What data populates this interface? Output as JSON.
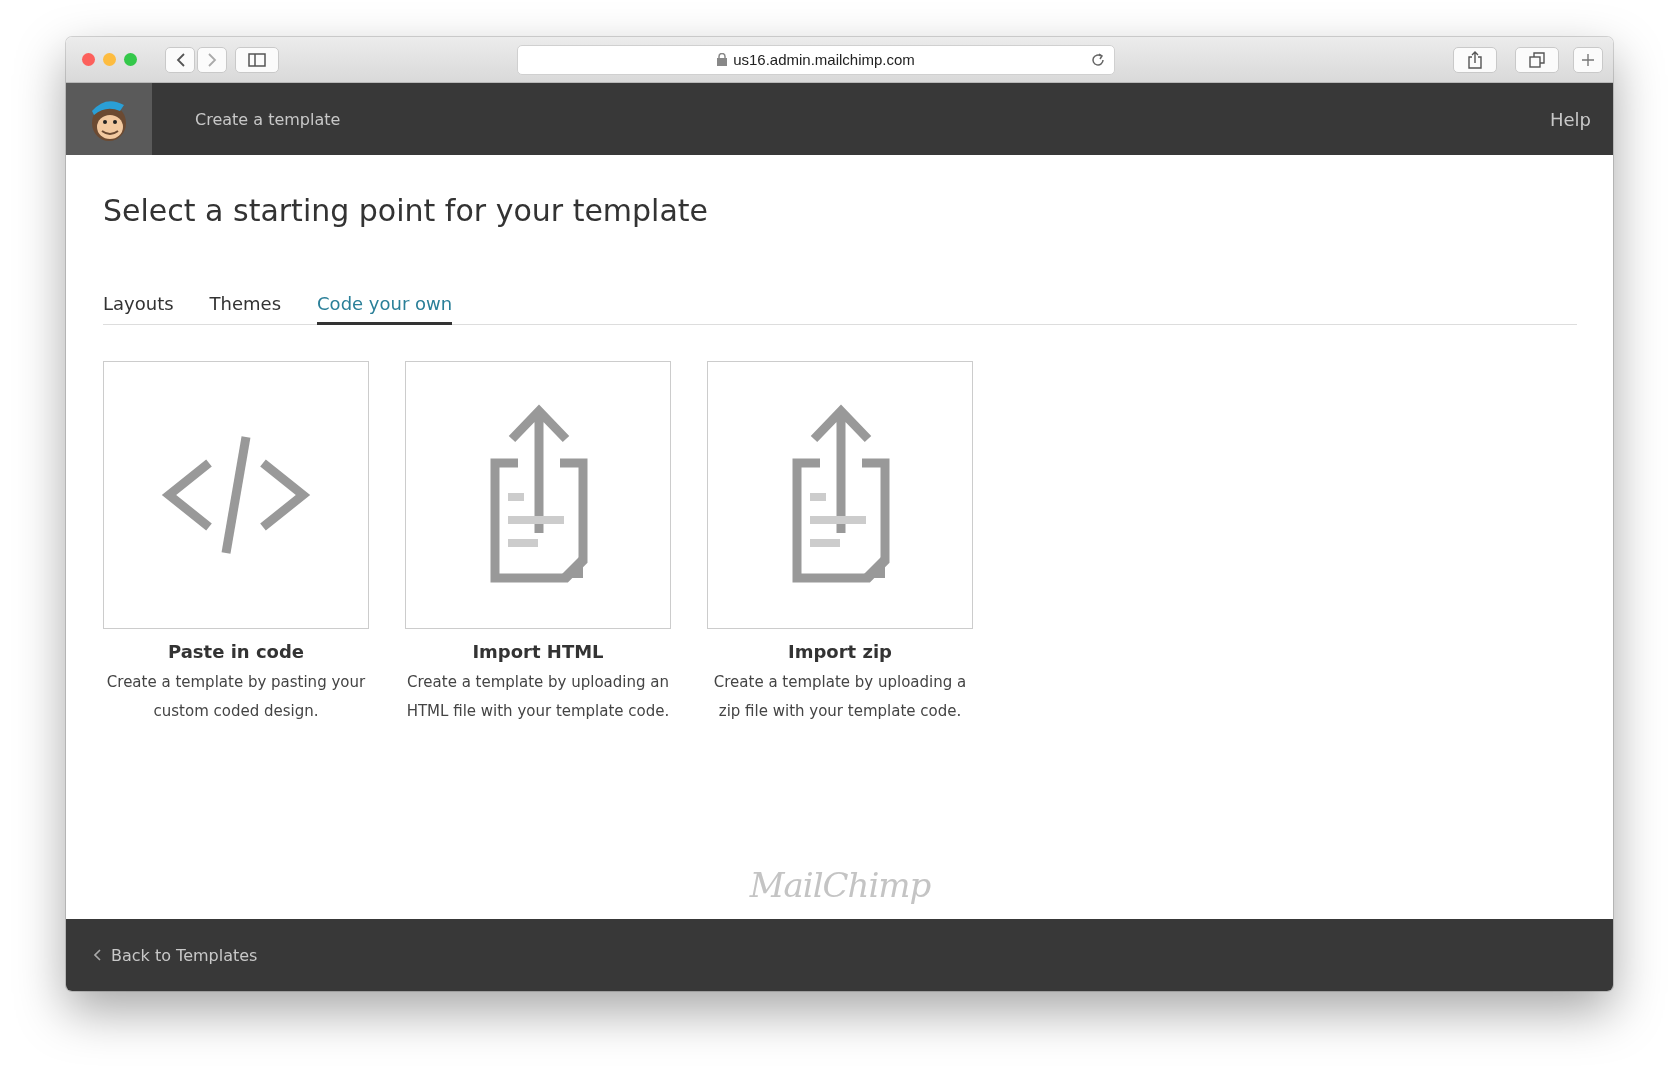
{
  "browser": {
    "url": "us16.admin.mailchimp.com"
  },
  "header": {
    "title": "Create a template",
    "help": "Help"
  },
  "page_title": "Select a starting point for your template",
  "tabs": [
    {
      "label": "Layouts",
      "selected": false
    },
    {
      "label": "Themes",
      "selected": false
    },
    {
      "label": "Code your own",
      "selected": true
    }
  ],
  "cards": [
    {
      "kind": "code",
      "title": "Paste in code",
      "description": "Create a template by pasting your custom coded design."
    },
    {
      "kind": "upload",
      "title": "Import HTML",
      "description": "Create a template by uploading an HTML file with your template code."
    },
    {
      "kind": "upload",
      "title": "Import zip",
      "description": "Create a template by uploading a zip file with your template code."
    }
  ],
  "wordmark": "MailChimp",
  "footer": {
    "back_link": "Back to Templates"
  }
}
